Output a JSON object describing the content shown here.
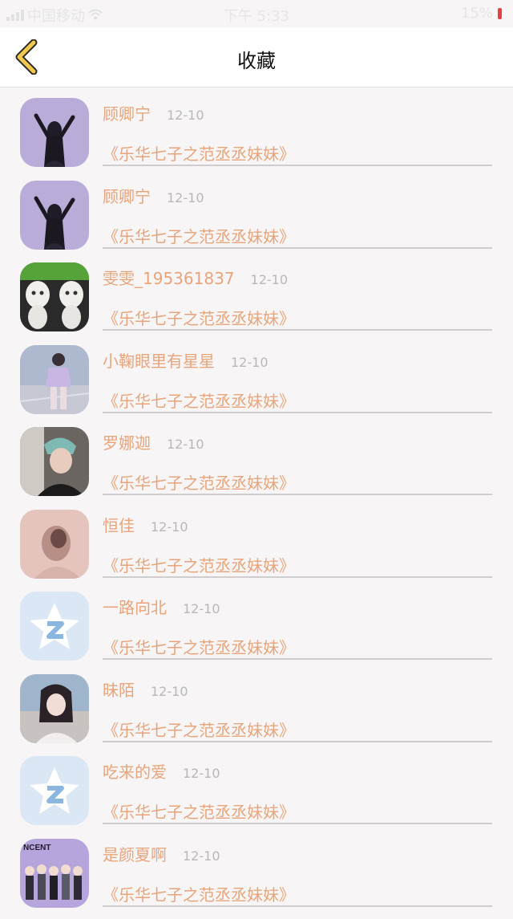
{
  "status_bar": {
    "carrier": "中国移动",
    "time": "下午 5:33",
    "battery": "15%"
  },
  "nav": {
    "title": "收藏",
    "back_icon": "chevron-left-icon",
    "accent": "#f2c94c"
  },
  "colors": {
    "name": "#e8a57b",
    "date": "#b8b8b8"
  },
  "favorites": [
    {
      "name": "顾卿宁",
      "date": "12-10",
      "work": "《乐华七子之范丞丞妹妹》",
      "avatar": "avatar-girl-purple"
    },
    {
      "name": "顾卿宁",
      "date": "12-10",
      "work": "《乐华七子之范丞丞妹妹》",
      "avatar": "avatar-girl-purple"
    },
    {
      "name": "雯雯_195361837",
      "date": "12-10",
      "work": "《乐华七子之范丞丞妹妹》",
      "avatar": "avatar-cats"
    },
    {
      "name": "小鞠眼里有星星",
      "date": "12-10",
      "work": "《乐华七子之范丞丞妹妹》",
      "avatar": "avatar-girl-street"
    },
    {
      "name": "罗娜迦",
      "date": "12-10",
      "work": "《乐华七子之范丞丞妹妹》",
      "avatar": "avatar-boy-teal-hair"
    },
    {
      "name": "恒佳",
      "date": "12-10",
      "work": "《乐华七子之范丞丞妹妹》",
      "avatar": "avatar-pink-blur"
    },
    {
      "name": "一路向北",
      "date": "12-10",
      "work": "《乐华七子之范丞丞妹妹》",
      "avatar": "avatar-qq-default"
    },
    {
      "name": "昧陌",
      "date": "12-10",
      "work": "《乐华七子之范丞丞妹妹》",
      "avatar": "avatar-girl-outdoor"
    },
    {
      "name": "吃来的爱",
      "date": "12-10",
      "work": "《乐华七子之范丞丞妹妹》",
      "avatar": "avatar-qq-default"
    },
    {
      "name": "是颜夏啊",
      "date": "12-10",
      "work": "《乐华七子之范丞丞妹妹》",
      "avatar": "avatar-group-cartoon",
      "avatar_text": "NCENT"
    }
  ]
}
